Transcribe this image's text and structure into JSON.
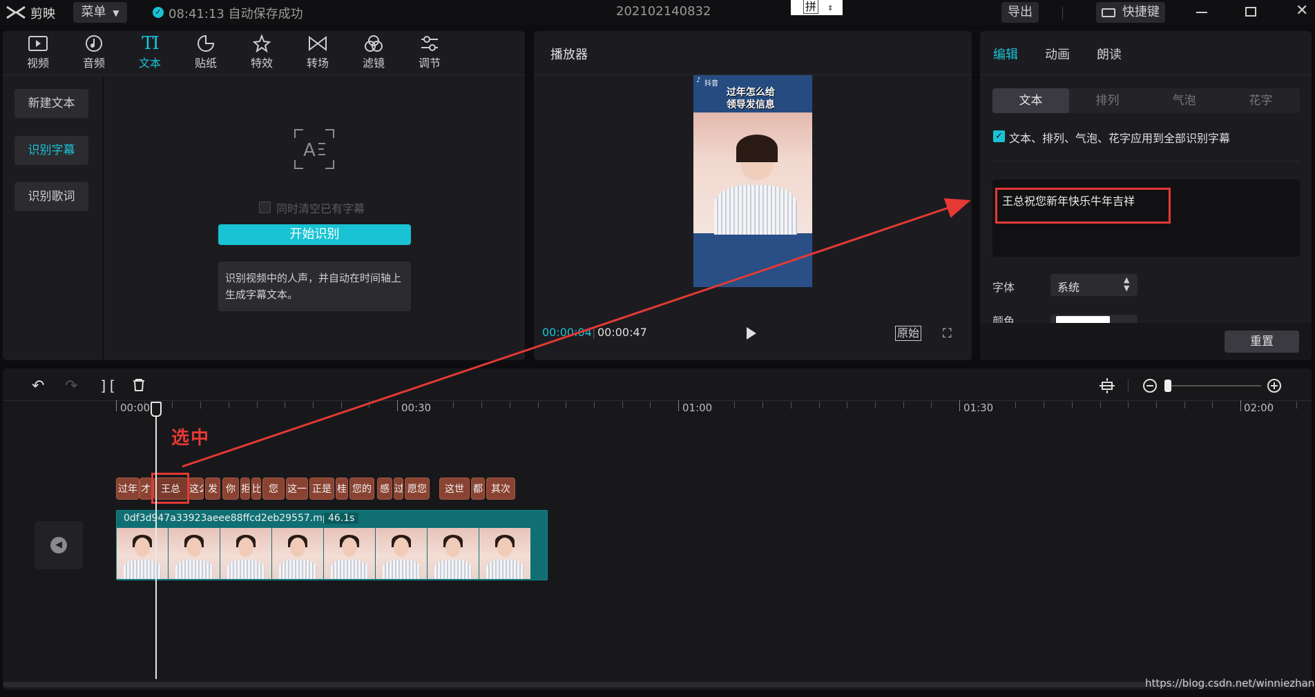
{
  "titlebar": {
    "app_name": "剪映",
    "menu_label": "菜单",
    "save_status": "08:41:13 自动保存成功",
    "project_name": "202102140832",
    "ime_label": "拼",
    "export_label": "导出",
    "shortcut_label": "快捷键"
  },
  "toolbar": {
    "items": [
      {
        "label": "视频",
        "icon": "video-icon"
      },
      {
        "label": "音频",
        "icon": "audio-icon"
      },
      {
        "label": "文本",
        "icon": "text-icon"
      },
      {
        "label": "贴纸",
        "icon": "sticker-icon"
      },
      {
        "label": "特效",
        "icon": "effects-icon"
      },
      {
        "label": "转场",
        "icon": "transition-icon"
      },
      {
        "label": "滤镜",
        "icon": "filter-icon"
      },
      {
        "label": "调节",
        "icon": "adjust-icon"
      }
    ]
  },
  "text_sidebar": {
    "items": [
      "新建文本",
      "识别字幕",
      "识别歌词"
    ]
  },
  "recognize": {
    "checkbox_label": "同时清空已有字幕",
    "start_button": "开始识别",
    "description": "识别视频中的人声，并自动在时间轴上生成字幕文本。"
  },
  "player": {
    "title": "播放器",
    "current_time": "00:00:04",
    "total_time": "00:00:47",
    "original_label": "原始",
    "video_watermark": "抖音",
    "video_subtitle_line1": "过年怎么给",
    "video_subtitle_line2": "领导发信息"
  },
  "inspector": {
    "tabs": [
      "编辑",
      "动画",
      "朗读"
    ],
    "subtabs": [
      "文本",
      "排列",
      "气泡",
      "花字"
    ],
    "apply_all_label": "文本、排列、气泡、花字应用到全部识别字幕",
    "text_value": "王总祝您新年快乐牛年吉祥",
    "font_label": "字体",
    "font_value": "系统",
    "color_label": "颜色",
    "reset_label": "重置"
  },
  "timeline": {
    "ruler": [
      "00:00",
      "00:30",
      "01:00",
      "01:30",
      "02:00"
    ],
    "annotation": "选中",
    "chips": [
      "过年",
      "才",
      "王总",
      "这么",
      "发",
      "你",
      "拒",
      "比",
      "您",
      "这一",
      "正是",
      "桂",
      "您的",
      "感",
      "过",
      "愿您",
      "这世",
      "都",
      "其次"
    ],
    "video_clip_name": "0df3d947a33923aeee88ffcd2eb29557.mp4",
    "video_clip_duration": "46.1s"
  },
  "footer": {
    "watermark": "https://blog.csdn.net/winniezhang"
  },
  "colors": {
    "accent": "#19c3d4",
    "subtitle_chip": "#8a4332",
    "video_track": "#0f6f73",
    "highlight": "#e53935"
  }
}
